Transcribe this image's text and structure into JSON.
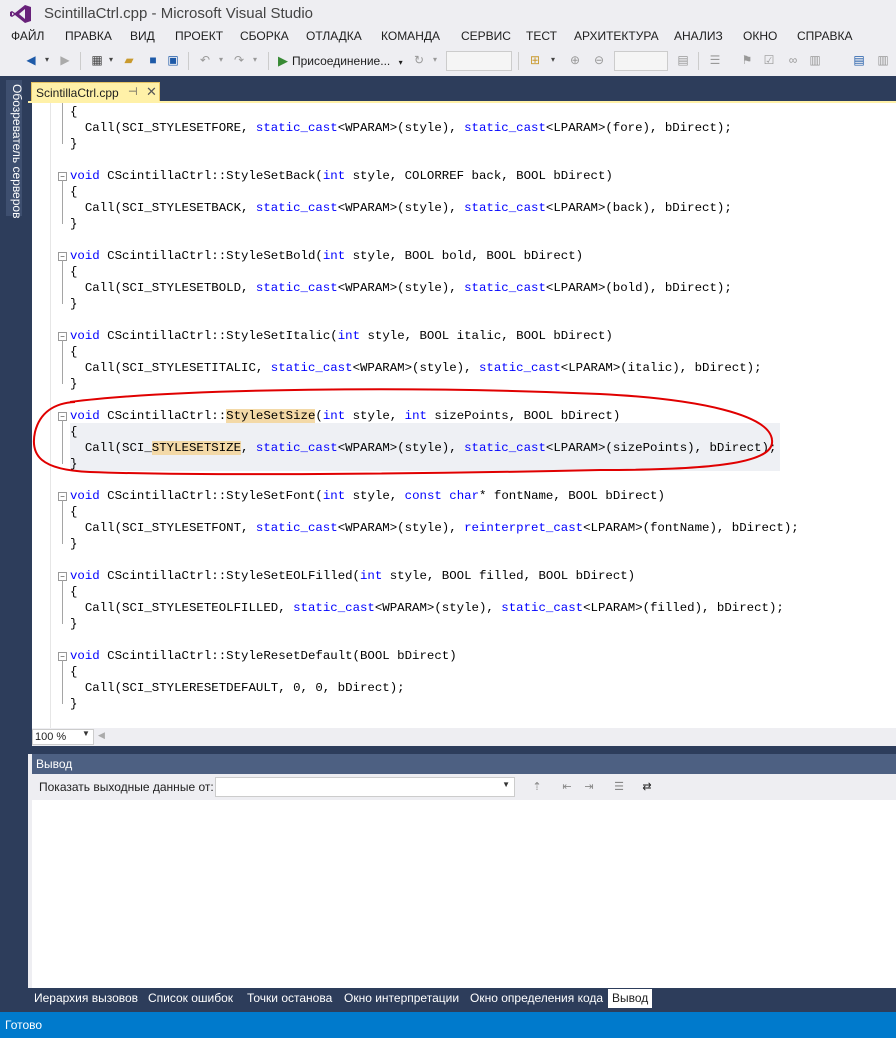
{
  "window": {
    "title": "ScintillaCtrl.cpp - Microsoft Visual Studio"
  },
  "menu": [
    "ФАЙЛ",
    "ПРАВКА",
    "ВИД",
    "ПРОЕКТ",
    "СБОРКА",
    "ОТЛАДКА",
    "КОМАНДА",
    "СЕРВИС",
    "ТЕСТ",
    "АРХИТЕКТУРА",
    "АНАЛИЗ",
    "ОКНО",
    "СПРАВКА"
  ],
  "toolbar": {
    "start_label": "Присоединение..."
  },
  "side_panel": {
    "label": "Обозреватель серверов"
  },
  "document_tab": {
    "name": "ScintillaCtrl.cpp",
    "pin": "⊣",
    "close": "✕"
  },
  "editor": {
    "zoom": "100 %",
    "lines": [
      "{",
      "  Call(SCI_STYLESETFORE, static_cast<WPARAM>(style), static_cast<LPARAM>(fore), bDirect);",
      "}",
      "",
      "void CScintillaCtrl::StyleSetBack(int style, COLORREF back, BOOL bDirect)",
      "{",
      "  Call(SCI_STYLESETBACK, static_cast<WPARAM>(style), static_cast<LPARAM>(back), bDirect);",
      "}",
      "",
      "void CScintillaCtrl::StyleSetBold(int style, BOOL bold, BOOL bDirect)",
      "{",
      "  Call(SCI_STYLESETBOLD, static_cast<WPARAM>(style), static_cast<LPARAM>(bold), bDirect);",
      "}",
      "",
      "void CScintillaCtrl::StyleSetItalic(int style, BOOL italic, BOOL bDirect)",
      "{",
      "  Call(SCI_STYLESETITALIC, static_cast<WPARAM>(style), static_cast<LPARAM>(italic), bDirect);",
      "}",
      "",
      "void CScintillaCtrl::StyleSetSize(int style, int sizePoints, BOOL bDirect)",
      "{",
      "  Call(SCI_STYLESETSIZE, static_cast<WPARAM>(style), static_cast<LPARAM>(sizePoints), bDirect);",
      "}",
      "",
      "void CScintillaCtrl::StyleSetFont(int style, const char* fontName, BOOL bDirect)",
      "{",
      "  Call(SCI_STYLESETFONT, static_cast<WPARAM>(style), reinterpret_cast<LPARAM>(fontName), bDirect);",
      "}",
      "",
      "void CScintillaCtrl::StyleSetEOLFilled(int style, BOOL filled, BOOL bDirect)",
      "{",
      "  Call(SCI_STYLESETEOLFILLED, static_cast<WPARAM>(style), static_cast<LPARAM>(filled), bDirect);",
      "}",
      "",
      "void CScintillaCtrl::StyleResetDefault(BOOL bDirect)",
      "{",
      "  Call(SCI_STYLERESETDEFAULT, 0, 0, bDirect);",
      "}"
    ]
  },
  "output_panel": {
    "title": "Вывод",
    "show_output_from": "Показать выходные данные от:",
    "source_value": ""
  },
  "bottom_tabs": [
    "Иерархия вызовов",
    "Список ошибок",
    "Точки останова",
    "Окно интерпретации",
    "Окно определения кода",
    "Вывод"
  ],
  "status": {
    "text": "Готово"
  },
  "colors": {
    "accent": "#007acc",
    "frame": "#2d3d5b",
    "keyword": "#0000ff",
    "annotation": "#e00000"
  }
}
